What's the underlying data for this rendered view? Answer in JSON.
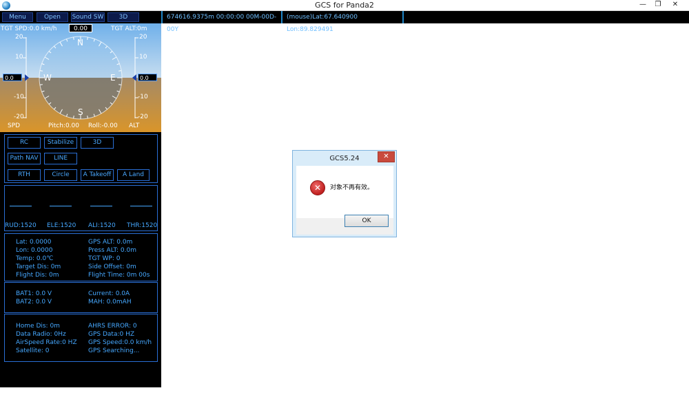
{
  "window": {
    "title": "GCS for Panda2",
    "min_glyph": "—",
    "max_glyph": "❐",
    "close_glyph": "✕"
  },
  "toolbar": {
    "menu": "Menu",
    "open": "Open",
    "sound": "Sound SW",
    "view3d": "3D"
  },
  "status_bar": {
    "distance_time": "674616.9375m   00:00:00 00M-00D-00Y",
    "mouse": "(mouse)Lat:67.640900 Lon:89.829491"
  },
  "hud": {
    "tgt_spd": "TGT SPD:0.0 km/h",
    "tgt_alt": "TGT ALT:0m",
    "heading": "0.00",
    "speed_value": "0.0",
    "alt_value": "0.0",
    "spd_label": "SPD",
    "alt_label": "ALT",
    "pitch": "Pitch:0.00",
    "roll": "Roll:-0.00",
    "scale": [
      "20",
      "10",
      "0",
      "-10",
      "-20"
    ],
    "compass": [
      "N",
      "E",
      "S",
      "W"
    ]
  },
  "modes": {
    "rc": "RC",
    "stabilize": "Stabilize",
    "m3d": "3D",
    "path_nav": "Path NAV",
    "line": "LINE",
    "rth": "RTH",
    "circle": "Circle",
    "takeoff": "A Takeoff",
    "land": "A Land"
  },
  "rc_channels": {
    "rud": "RUD:1520",
    "ele": "ELE:1520",
    "ali": "ALI:1520",
    "thr": "THR:1520"
  },
  "telemetry": {
    "lat": "Lat: 0.0000",
    "lon": "Lon: 0.0000",
    "temp": "Temp: 0.0℃",
    "target_dis": "Target Dis: 0m",
    "flight_dis": "Flight Dis: 0m",
    "gps_alt": "GPS ALT: 0.0m",
    "press_alt": "Press ALT: 0.0m",
    "tgt_wp": "TGT WP: 0",
    "side_offset": "Side Offset: 0m",
    "flight_time": "Flight Time: 0m 00s"
  },
  "battery": {
    "bat1": "BAT1: 0.0 V",
    "bat2": "BAT2: 0.0 V",
    "current": "Current: 0.0A",
    "mah": "MAH: 0.0mAH"
  },
  "status": {
    "home_dis": "Home Dis: 0m",
    "data_radio": "Data Radio: 0Hz",
    "airspeed_rate": "AirSpeed Rate:0 HZ",
    "satellite": "Satellite: 0",
    "ahrs_error": "AHRS ERROR: 0",
    "gps_data": "GPS Data:0 HZ",
    "gps_speed": "GPS Speed:0.0 km/h",
    "gps_searching": "GPS Searching..."
  },
  "dialog": {
    "title": "GCS5.24",
    "message": "对象不再有效。",
    "ok": "OK",
    "close_glyph": "✕",
    "error_glyph": "✕"
  },
  "colors": {
    "sky": "#9fc9ef",
    "ground": "#c89030",
    "accent": "#46a8ff",
    "panel_bg": "#000000"
  }
}
